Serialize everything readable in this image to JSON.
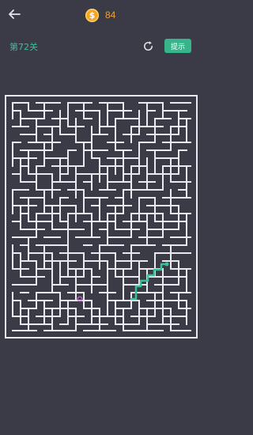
{
  "header": {
    "coins": "84",
    "coin_glyph": "$"
  },
  "level": {
    "label": "第72关",
    "hint_label": "提示"
  },
  "icons": {
    "back": "arrow-left-icon",
    "restart": "restart-icon",
    "coin": "coin-icon"
  },
  "colors": {
    "background": "#3b3b47",
    "wall": "#e9e9ee",
    "accent": "#37c197",
    "coin": "#f4a623",
    "player": "#d46ad6"
  }
}
